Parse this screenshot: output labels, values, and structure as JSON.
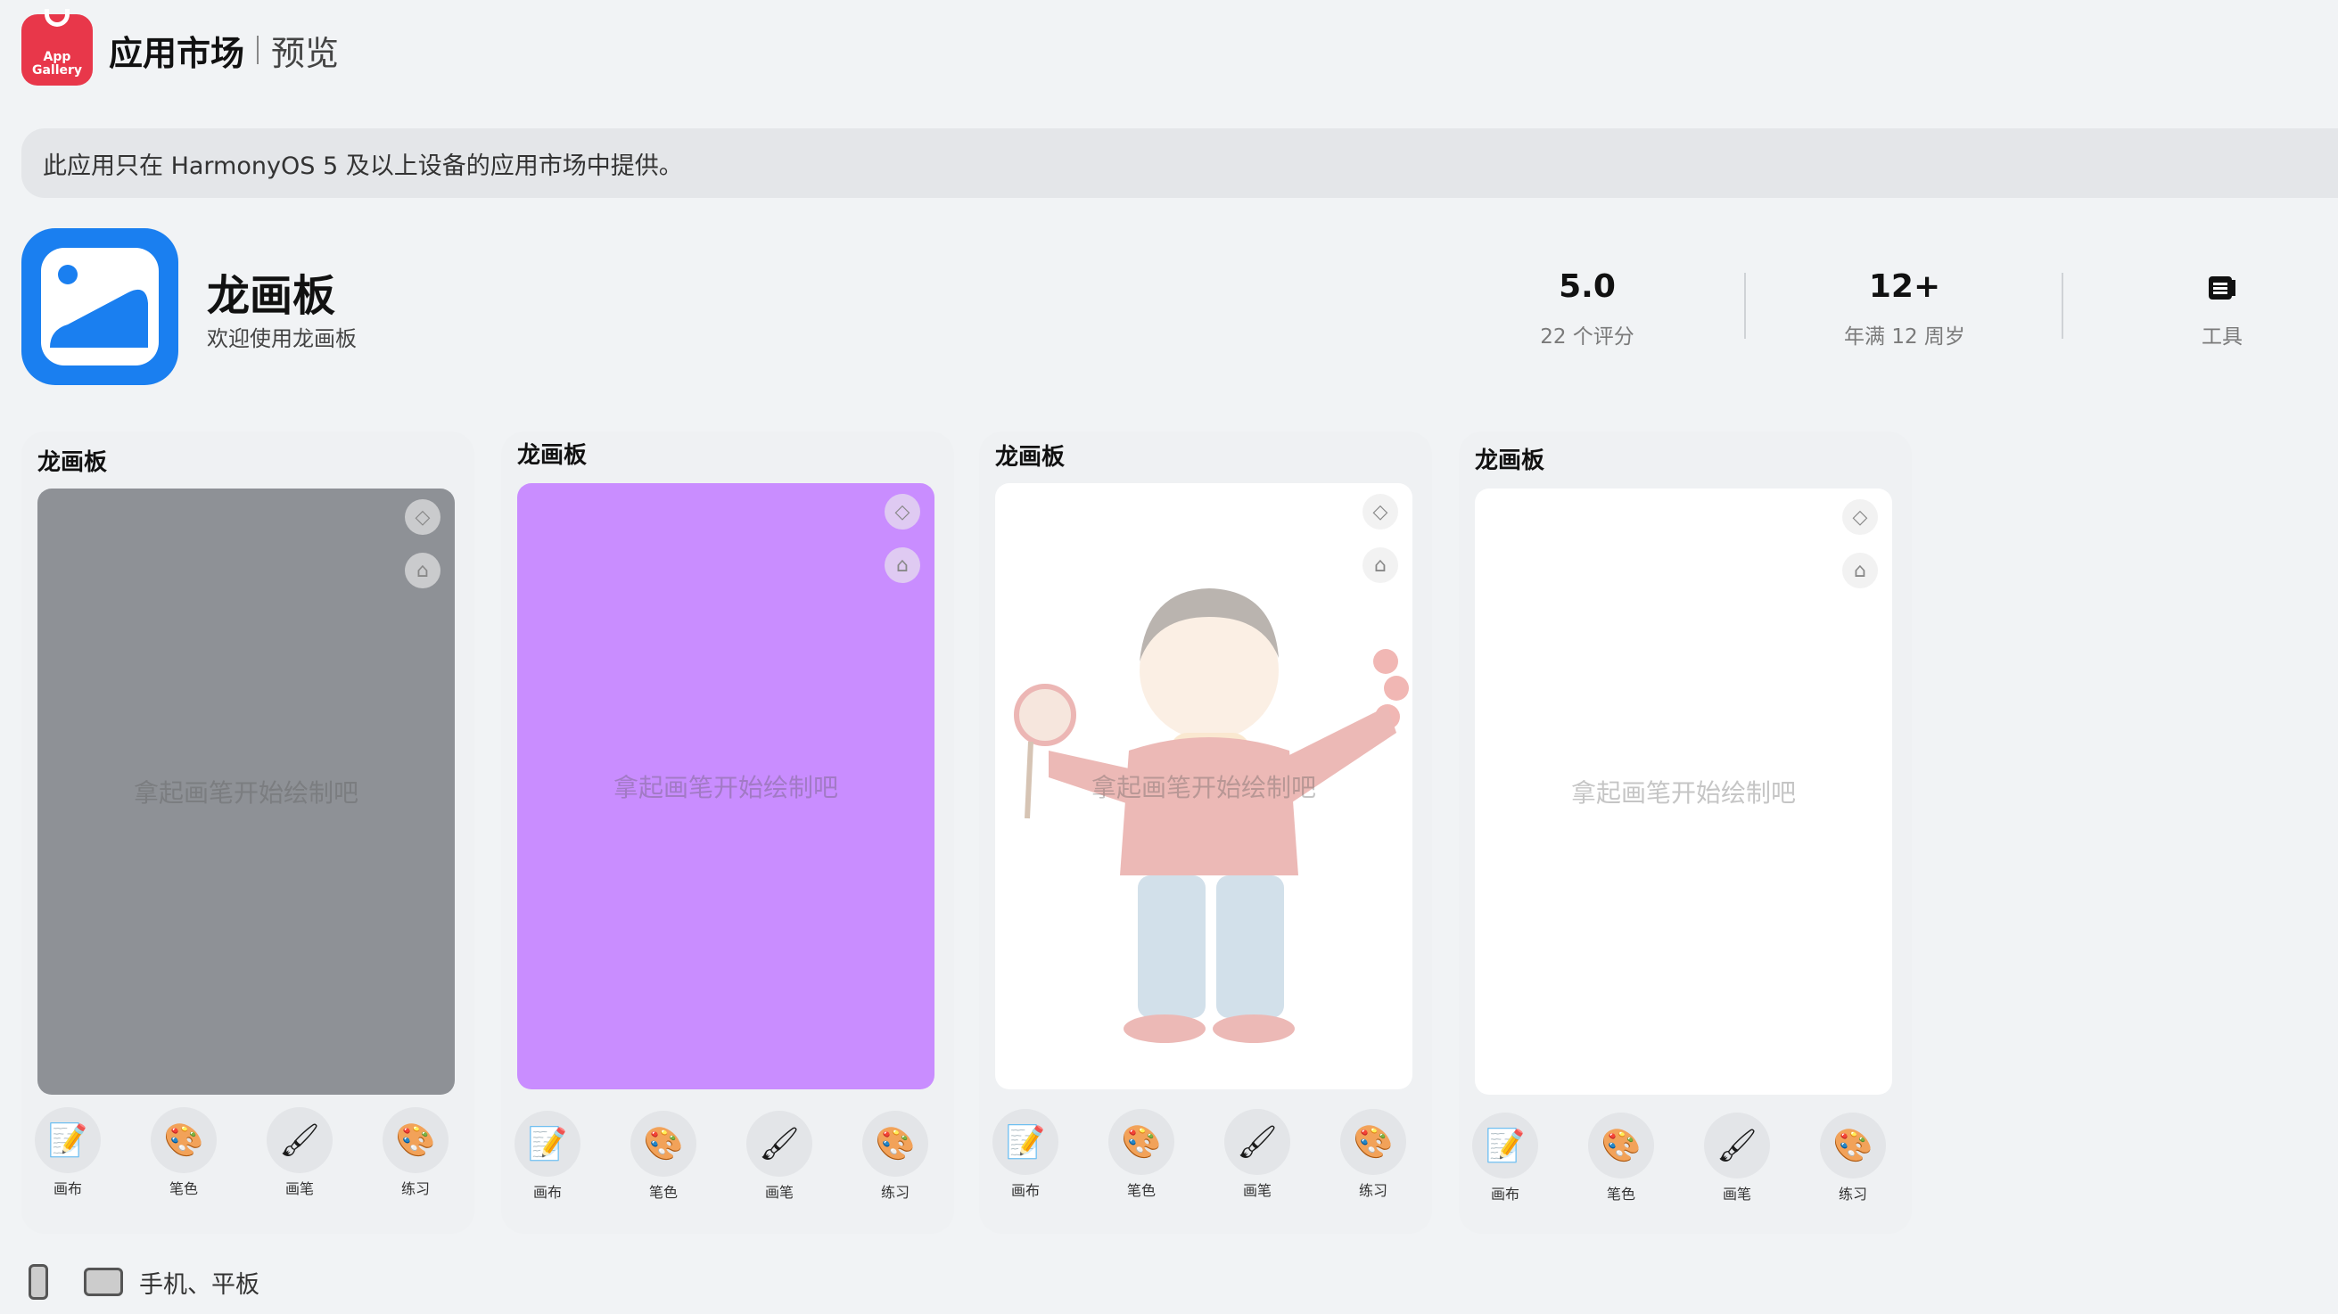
{
  "header": {
    "logo_line1": "App",
    "logo_line2": "Gallery",
    "title": "应用市场",
    "subtitle": "预览"
  },
  "notice": "此应用只在 HarmonyOS 5 及以上设备的应用市场中提供。",
  "app": {
    "name": "龙画板",
    "description": "欢迎使用龙画板"
  },
  "stats": [
    {
      "value": "5.0",
      "label": "22 个评分"
    },
    {
      "value": "12+",
      "label": "年满 12 周岁"
    },
    {
      "icon": "book-icon",
      "label": "工具"
    }
  ],
  "colors": {
    "accent": "#1a7ff0",
    "store": "#e8374a",
    "purple": "#c98dff",
    "gray": "#8e9196"
  },
  "screenshots": [
    {
      "title": "龙画板",
      "hint": "拿起画笔开始绘制吧",
      "canvas_color": "#8e9196"
    },
    {
      "title": "龙画板",
      "hint": "拿起画笔开始绘制吧",
      "canvas_color": "#c98dff"
    },
    {
      "title": "龙画板",
      "hint": "拿起画笔开始绘制吧",
      "canvas_color": "#ffffff"
    },
    {
      "title": "龙画板",
      "hint": "拿起画笔开始绘制吧",
      "canvas_color": "#ffffff"
    }
  ],
  "toolbar": [
    {
      "label": "画布",
      "icon": "📝"
    },
    {
      "label": "笔色",
      "icon": "🎨"
    },
    {
      "label": "画笔",
      "icon": "🖌"
    },
    {
      "label": "练习",
      "icon": "🎨"
    }
  ],
  "footer": {
    "devices": "手机、平板"
  }
}
